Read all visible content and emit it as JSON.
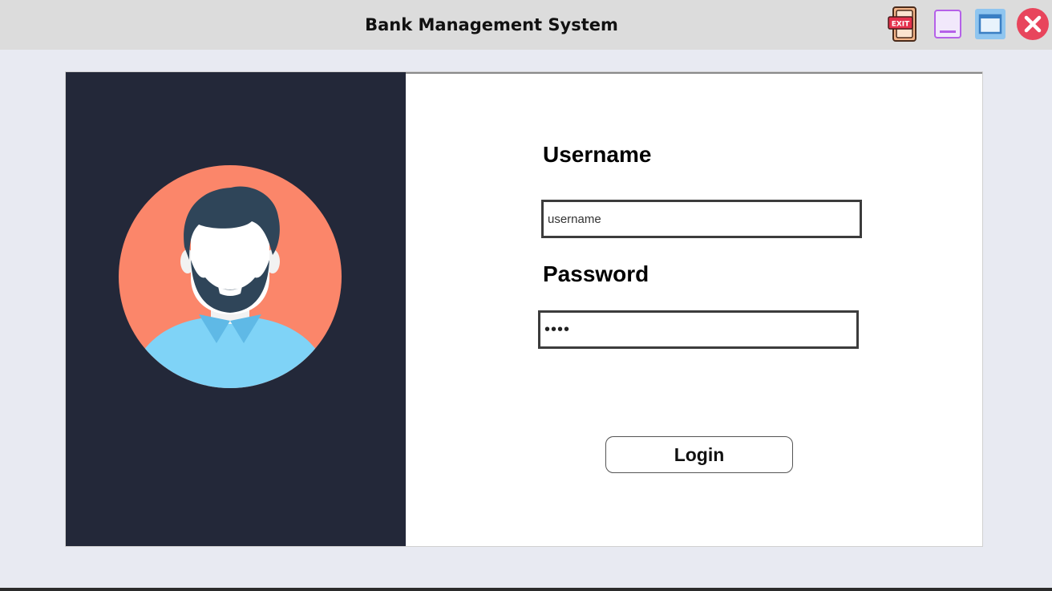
{
  "window": {
    "title": "Bank Management System",
    "icons": [
      "exit-icon",
      "minimize-icon",
      "maximize-icon",
      "close-icon"
    ],
    "exit_icon_text": "EXIT"
  },
  "colors": {
    "titlebar_bg": "#dcdcdc",
    "window_bg": "#e8eaf2",
    "left_panel_bg": "#232839",
    "avatar_circle": "#fb866a",
    "avatar_shirt": "#7fd3f7",
    "avatar_hair": "#2f4559",
    "close_red": "#e8455c"
  },
  "login_form": {
    "username_label": "Username",
    "username_placeholder": "username",
    "password_label": "Password",
    "password_value": "••••",
    "login_button_label": "Login"
  },
  "illustration": {
    "avatar_icon": "user-avatar-icon"
  }
}
